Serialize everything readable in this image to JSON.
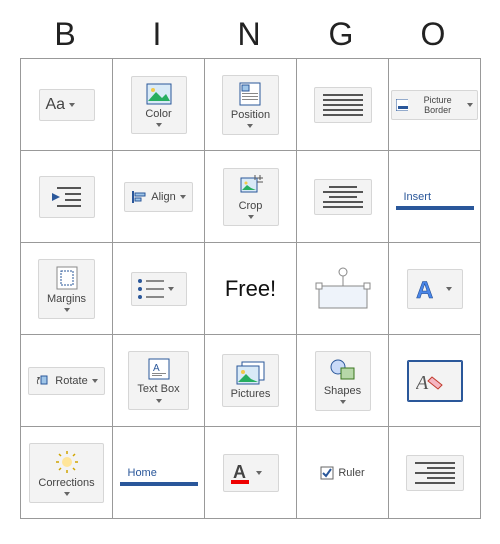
{
  "header": [
    "B",
    "I",
    "N",
    "G",
    "O"
  ],
  "cells": {
    "r0c0": {
      "label": "Aa"
    },
    "r0c1": {
      "label": "Color"
    },
    "r0c2": {
      "label": "Position"
    },
    "r0c3": {
      "label": ""
    },
    "r0c4": {
      "label": "Picture Border"
    },
    "r1c0": {
      "label": ""
    },
    "r1c1": {
      "label": "Align"
    },
    "r1c2": {
      "label": "Crop"
    },
    "r1c3": {
      "label": ""
    },
    "r1c4": {
      "label": "Insert"
    },
    "r2c0": {
      "label": "Margins"
    },
    "r2c1": {
      "label": ""
    },
    "r2c2": {
      "label": "Free!"
    },
    "r2c3": {
      "label": ""
    },
    "r2c4": {
      "label": ""
    },
    "r3c0": {
      "label": "Rotate"
    },
    "r3c1": {
      "label": "Text Box"
    },
    "r3c2": {
      "label": "Pictures"
    },
    "r3c3": {
      "label": "Shapes"
    },
    "r3c4": {
      "label": ""
    },
    "r4c0": {
      "label": "Corrections"
    },
    "r4c1": {
      "label": "Home"
    },
    "r4c2": {
      "label": ""
    },
    "r4c3": {
      "label": "Ruler"
    },
    "r4c4": {
      "label": ""
    }
  }
}
